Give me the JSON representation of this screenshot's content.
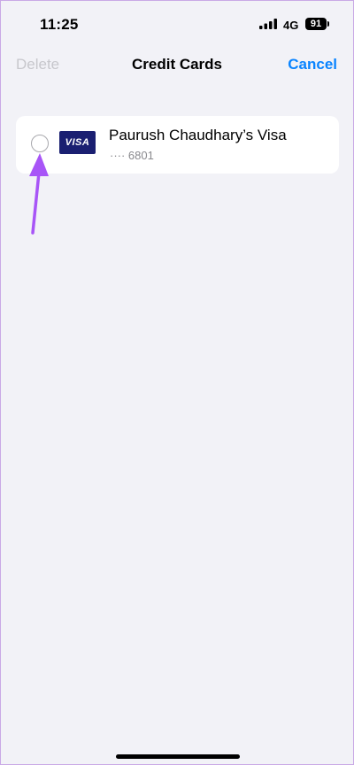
{
  "status_bar": {
    "time": "11:25",
    "network": "4G",
    "battery_level": "91"
  },
  "nav": {
    "delete_label": "Delete",
    "title": "Credit Cards",
    "cancel_label": "Cancel"
  },
  "cards": [
    {
      "brand": "VISA",
      "name": "Paurush Chaudhary’s Visa",
      "number": "···· 6801"
    }
  ],
  "colors": {
    "accent": "#0a84ff",
    "background": "#f2f2f7",
    "visa_blue": "#1a1f71",
    "annotation_arrow": "#a855f7"
  }
}
